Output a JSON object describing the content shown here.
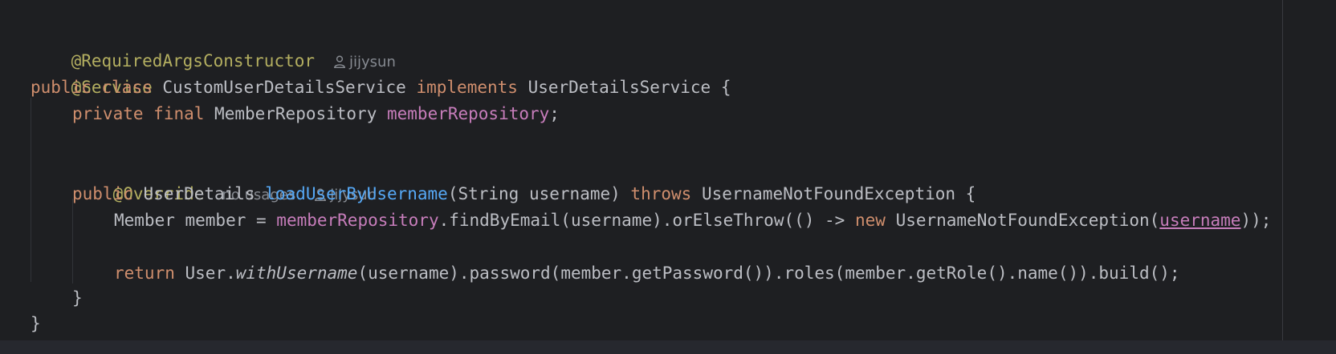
{
  "code": {
    "annotation_required_args": "@RequiredArgsConstructor",
    "annotation_service": "@Service",
    "kw_public": "public",
    "kw_class": "class",
    "class_name": "CustomUserDetailsService",
    "kw_implements": "implements",
    "interface_name": "UserDetailsService",
    "brace_open": "{",
    "kw_private": "private",
    "kw_final": "final",
    "field_type": "MemberRepository",
    "field_name": "memberRepository",
    "semicolon": ";",
    "annotation_override": "@Override",
    "return_type": "UserDetails",
    "method_name": "loadUserByUsername",
    "params": "(String username)",
    "kw_throws": "throws",
    "exception_type": "UsernameNotFoundException",
    "local_decl": "Member member = ",
    "find_call": ".findByEmail(username).orElseThrow(() -> ",
    "kw_new": "new",
    "exception_ctor": "UsernameNotFoundException(",
    "param_ref": "username",
    "close_paren_semicolon": "));",
    "kw_return": "return",
    "user_class": "User.",
    "with_username": "withUsername",
    "builder_chain": "(username).password(member.getPassword()).roles(member.getRole().name()).build();",
    "method_brace_close": "}",
    "class_brace_close": "}"
  },
  "hints": {
    "author_class": "jijysun",
    "usages_method": "no usages",
    "author_method": "jijysun"
  },
  "icons": {
    "author": "person-icon"
  }
}
